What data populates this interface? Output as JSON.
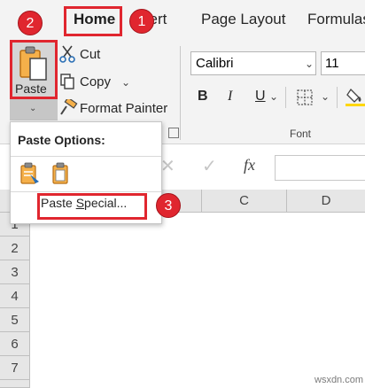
{
  "tabs": {
    "home": "Home",
    "insert_partial": "sert",
    "page_layout": "Page Layout",
    "formulas": "Formulas"
  },
  "clipboard": {
    "paste_label": "Paste",
    "cut_label": "Cut",
    "copy_label": "Copy",
    "format_painter_label": "Format Painter"
  },
  "font": {
    "font_name": "Calibri",
    "font_size": "11",
    "group_label": "Font",
    "bold_label": "B",
    "italic_label": "I",
    "underline_label": "U"
  },
  "formula_bar": {
    "fx_label": "fx"
  },
  "grid": {
    "columns": [
      "C",
      "D"
    ],
    "rows": [
      "1",
      "2",
      "3",
      "4",
      "5",
      "6",
      "7"
    ]
  },
  "paste_menu": {
    "title": "Paste Options:",
    "paste_special_prefix": "Paste ",
    "paste_special_accel": "S",
    "paste_special_suffix": "pecial..."
  },
  "badges": {
    "one": "1",
    "two": "2",
    "three": "3"
  },
  "colors": {
    "accent_green": "#217346",
    "annotation_red": "#e0262f"
  },
  "watermark": "wsxdn.com"
}
